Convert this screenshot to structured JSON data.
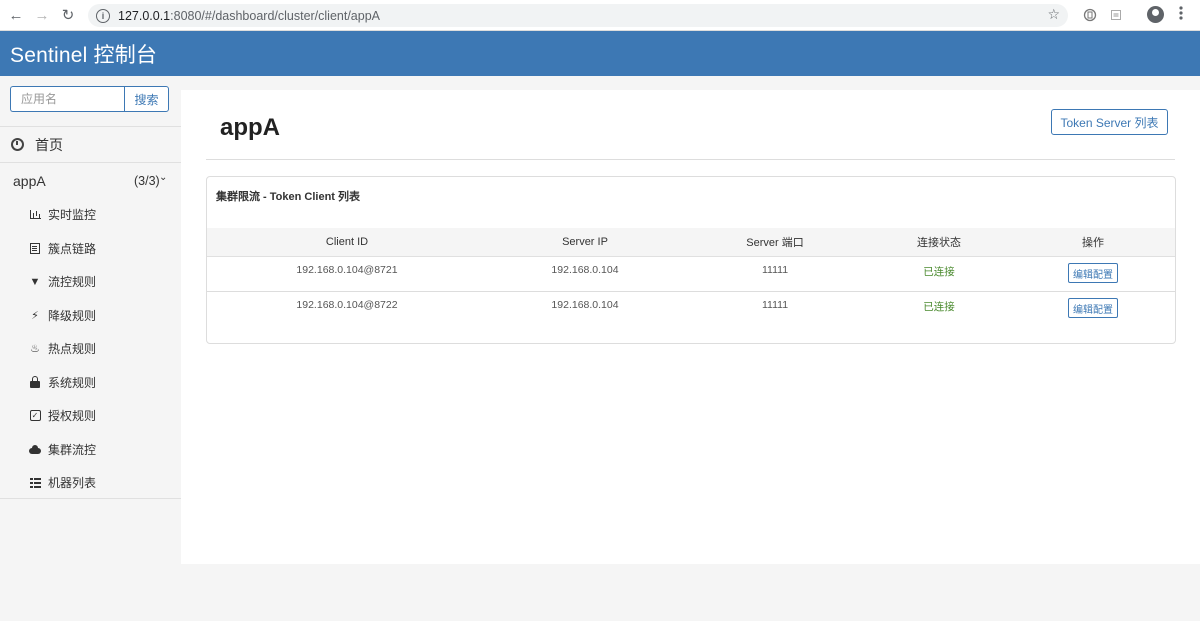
{
  "browser": {
    "url_host": "127.0.0.1",
    "url_rest": ":8080/#/dashboard/cluster/client/appA",
    "back_icon": "←",
    "forward_icon": "→",
    "reload_icon": "↻",
    "info_icon": "i",
    "star_icon": "☆"
  },
  "header": {
    "title": "Sentinel 控制台"
  },
  "sidebar": {
    "search_placeholder": "应用名",
    "search_button": "搜索",
    "home_label": "首页",
    "app_name": "appA",
    "app_count": "(3/3)",
    "chevron": "⌄",
    "items": [
      {
        "label": "实时监控",
        "icon": "bar-chart-icon"
      },
      {
        "label": "簇点链路",
        "icon": "document-icon"
      },
      {
        "label": "流控规则",
        "icon": "filter-icon",
        "glyph": "▼"
      },
      {
        "label": "降级规则",
        "icon": "lightning-icon",
        "glyph": "⚡"
      },
      {
        "label": "热点规则",
        "icon": "fire-icon",
        "glyph": "♨"
      },
      {
        "label": "系统规则",
        "icon": "lock-icon"
      },
      {
        "label": "授权规则",
        "icon": "check-square-icon",
        "glyph": "✓"
      },
      {
        "label": "集群流控",
        "icon": "cloud-icon"
      },
      {
        "label": "机器列表",
        "icon": "list-icon"
      }
    ]
  },
  "main": {
    "page_title": "appA",
    "token_server_button": "Token Server 列表",
    "panel_title": "集群限流 - Token Client 列表",
    "columns": [
      "Client ID",
      "Server IP",
      "Server 端口",
      "连接状态",
      "操作"
    ],
    "rows": [
      {
        "client_id": "192.168.0.104@8721",
        "server_ip": "192.168.0.104",
        "server_port": "11111",
        "status": "已连接",
        "action": "编辑配置"
      },
      {
        "client_id": "192.168.0.104@8722",
        "server_ip": "192.168.0.104",
        "server_port": "11111",
        "status": "已连接",
        "action": "编辑配置"
      }
    ],
    "status_color": "#4a8a2e",
    "accent_color": "#3d78b4"
  }
}
